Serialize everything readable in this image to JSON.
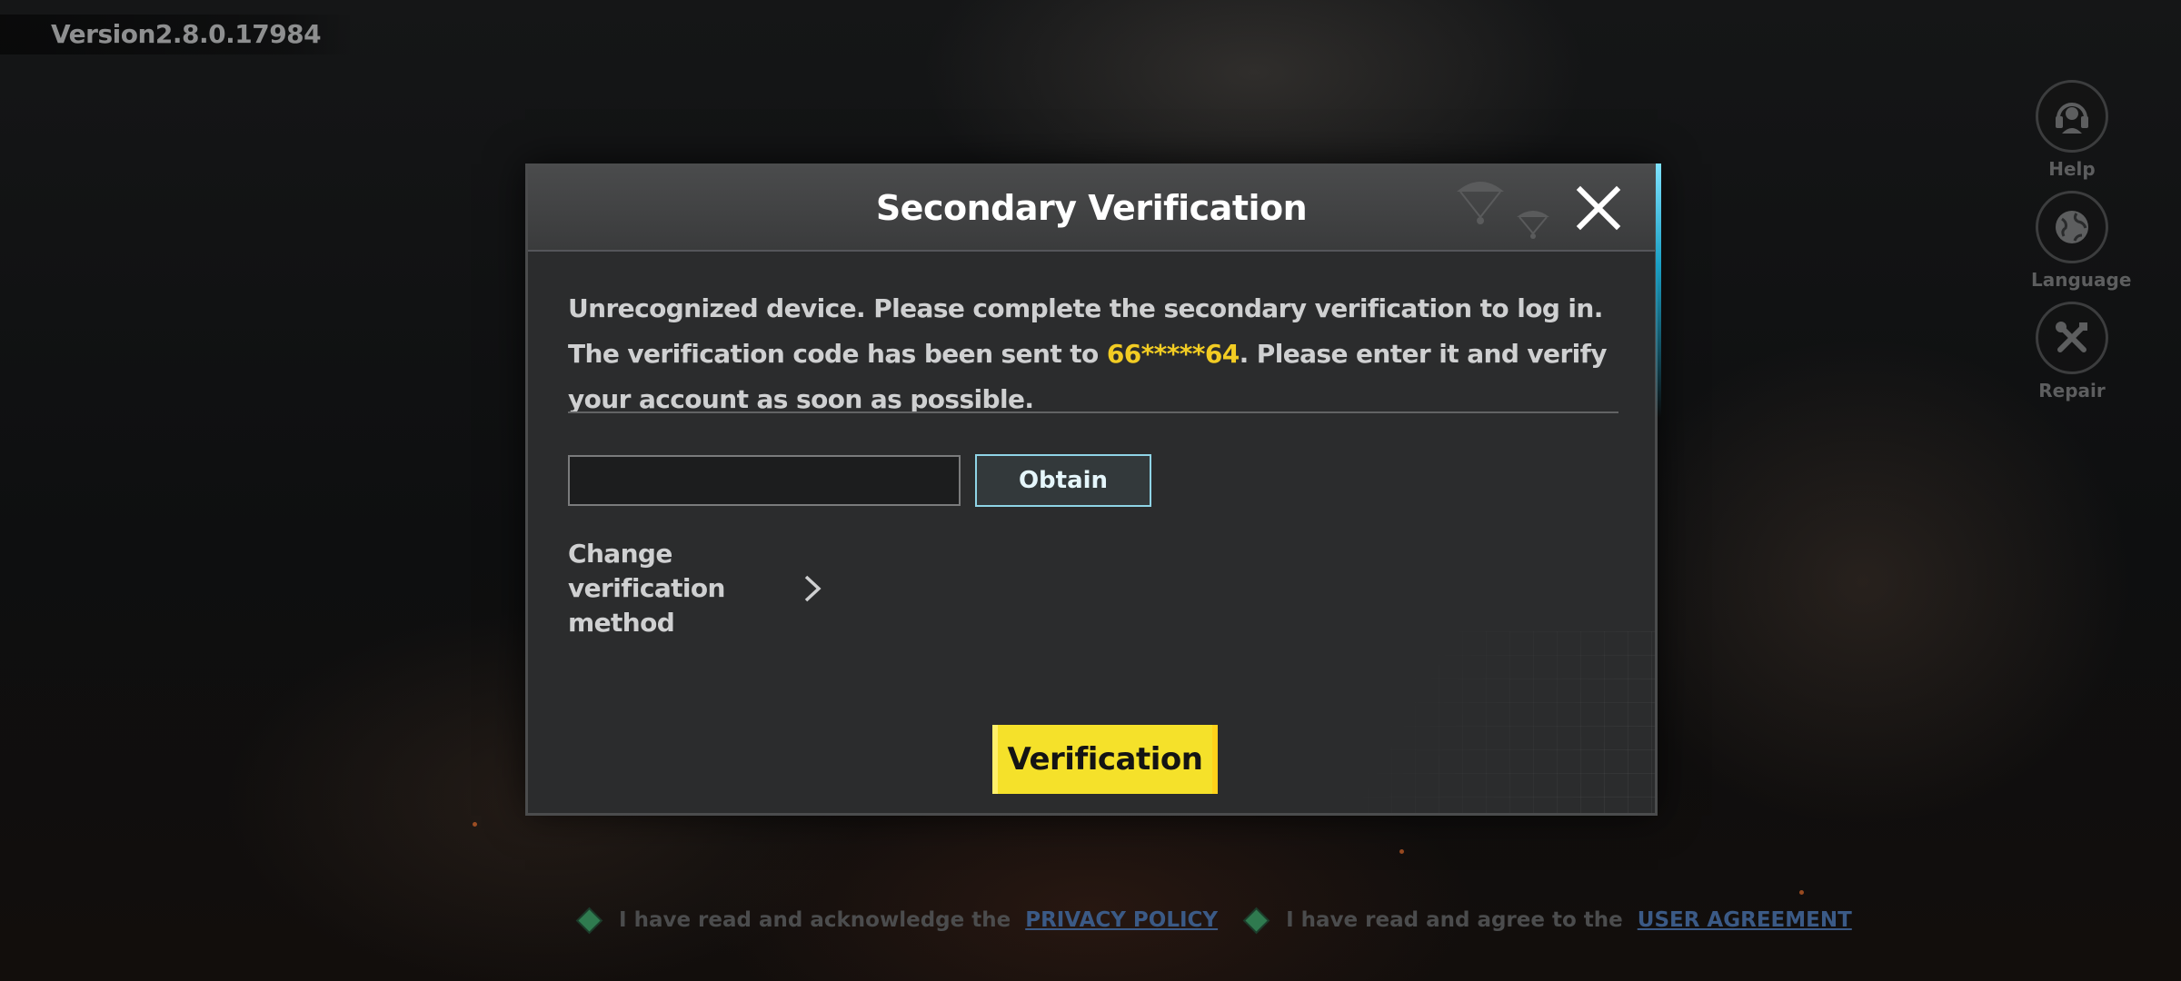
{
  "app": {
    "version": "Version2.8.0.17984"
  },
  "side_tools": [
    {
      "label": "Help",
      "icon": "headset-icon"
    },
    {
      "label": "Language",
      "icon": "globe-icon"
    },
    {
      "label": "Repair",
      "icon": "tools-icon"
    }
  ],
  "dialog": {
    "title": "Secondary Verification",
    "close_icon": "close-icon",
    "message_part1": "Unrecognized device. Please complete the secondary verification to log in. The verification code has been sent to ",
    "masked_phone": "66*****64",
    "message_part2": ". Please enter it and verify your account as soon as possible.",
    "code_input": {
      "value": "",
      "placeholder": ""
    },
    "obtain_label": "Obtain",
    "change_method_label": "Change verification method",
    "verify_label": "Verification"
  },
  "agreements": {
    "privacy_text": "I have read and acknowledge the",
    "privacy_link": "PRIVACY POLICY",
    "user_text": "I have read and agree to the",
    "user_link": "USER AGREEMENT"
  },
  "colors": {
    "accent_yellow": "#F5E12A",
    "highlight_text": "#F2CC23",
    "obtain_border": "#8FD4E6",
    "link_blue": "#3B5A86",
    "check_green": "#2F7A4F"
  }
}
